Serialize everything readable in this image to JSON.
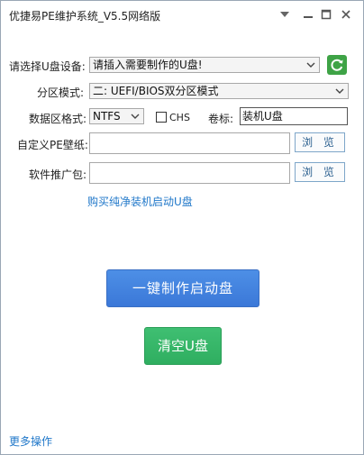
{
  "window": {
    "title": "优捷易PE维护系统_V5.5网络版"
  },
  "titlebar_icons": [
    "chevron-down-icon",
    "minimize-icon",
    "maximize-icon",
    "close-icon"
  ],
  "form": {
    "device_label": "请选择U盘设备:",
    "device_value": "请插入需要制作的U盘!",
    "partition_label": "分区模式:",
    "partition_value": "二: UEFI/BIOS双分区模式",
    "format_label": "数据区格式:",
    "format_value": "NTFS",
    "chs_label": "CHS",
    "chs_checked": false,
    "volume_label": "卷标:",
    "volume_value": "装机U盘",
    "wallpaper_label": "自定义PE壁纸:",
    "wallpaper_value": "",
    "software_label": "软件推广包:",
    "software_value": "",
    "browse_label": "浏 览"
  },
  "buy_link": "购买纯净装机启动U盘",
  "actions": {
    "make_label": "一键制作启动盘",
    "clear_label": "清空U盘"
  },
  "footer": {
    "more_label": "更多操作"
  },
  "colors": {
    "blue_button": "#3b78d8",
    "green_button": "#2fae60",
    "refresh_green": "#3ea346",
    "link": "#1f77c9"
  }
}
